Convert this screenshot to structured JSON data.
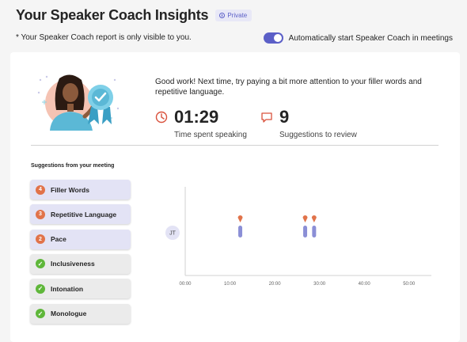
{
  "header": {
    "title": "Your Speaker Coach Insights",
    "badge": "Private"
  },
  "note": "* Your Speaker Coach report is only visible to you.",
  "auto_start": {
    "label": "Automatically start Speaker Coach in meetings",
    "enabled": true
  },
  "summary": {
    "message": "Good work! Next time, try paying a bit more attention to your filler words and repetitive language.",
    "time_value": "01:29",
    "time_label": "Time spent speaking",
    "time_icon": "clock-icon",
    "suggestions_value": "9",
    "suggestions_label": "Suggestions to review",
    "suggestions_icon": "speech-bubble-icon"
  },
  "suggestions": {
    "title": "Suggestions from your meeting",
    "items": [
      {
        "count": "4",
        "label": "Filler Words",
        "state": "active"
      },
      {
        "count": "3",
        "label": "Repetitive Language",
        "state": "active"
      },
      {
        "count": "2",
        "label": "Pace",
        "state": "active"
      },
      {
        "count": "",
        "label": "Inclusiveness",
        "state": "done"
      },
      {
        "count": "",
        "label": "Intonation",
        "state": "done"
      },
      {
        "count": "",
        "label": "Monologue",
        "state": "done"
      }
    ]
  },
  "timeline": {
    "speaker": "JT",
    "ticks": [
      "00:00",
      "10:00",
      "20:00",
      "30:00",
      "40:00",
      "50:00"
    ],
    "xmax_minutes": 55,
    "events_minutes": [
      12.3,
      26.8,
      28.8
    ]
  },
  "colors": {
    "accent": "#5b5fc7",
    "count_badge": "#e1734a",
    "check": "#5fb73a",
    "event_bar": "#8b8fd6",
    "event_marker": "#e1734a"
  }
}
